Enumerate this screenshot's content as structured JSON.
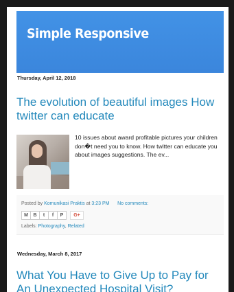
{
  "blog": {
    "title": "Simple Responsive"
  },
  "posts": [
    {
      "date": "Thursday, April 12, 2018",
      "title": "The evolution of beautiful images How twitter can educate",
      "snippet": "10 issues about award profitable pictures your children don\u0000t need you to know. How twitter can educate you about images suggestions. The ev...",
      "posted_by_prefix": "Posted by",
      "author": "Komunikasi Praktis",
      "at_word": "at",
      "time": "3:23 PM",
      "comments": "No comments:",
      "labels_prefix": "Labels:",
      "labels": [
        "Photography",
        "Related"
      ]
    },
    {
      "date": "Wednesday, March 8, 2017",
      "title": "What You Have to Give Up to Pay for An Unexpected Hospital Visit?"
    }
  ],
  "share_buttons": [
    {
      "icon": "email-icon",
      "glyph": "M"
    },
    {
      "icon": "blogthis-icon",
      "glyph": "B"
    },
    {
      "icon": "twitter-icon",
      "glyph": "t"
    },
    {
      "icon": "facebook-icon",
      "glyph": "f"
    },
    {
      "icon": "pinterest-icon",
      "glyph": "P"
    }
  ],
  "gplus": {
    "icon": "google-plus-icon",
    "label": "G+"
  },
  "colors": {
    "header": "#3d8ae0",
    "link": "#2288bb"
  }
}
